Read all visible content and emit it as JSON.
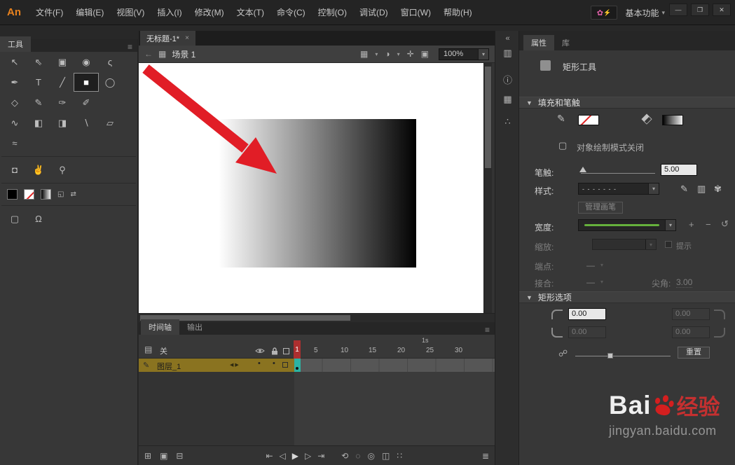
{
  "colors": {
    "stage_gradient_from": "#ffffff",
    "stage_gradient_to": "#000000",
    "annotation_arrow": "#e11d26",
    "playhead": "#ad2f2f",
    "layer_highlight": "#8a7320",
    "selected_frame": "#2bb3a3",
    "width_profile_green": "#66b13c",
    "baidu_red": "#d31f1f",
    "logo_orange": "#e8821e"
  },
  "menubar": {
    "logo": "An",
    "items": [
      "文件(F)",
      "编辑(E)",
      "视图(V)",
      "插入(I)",
      "修改(M)",
      "文本(T)",
      "命令(C)",
      "控制(O)",
      "调试(D)",
      "窗口(W)",
      "帮助(H)"
    ],
    "flower_icon": "✿",
    "spark_icon": "⚡",
    "workspace_label": "基本功能",
    "caret_icon": "▾",
    "minimize_icon": "—",
    "restore_icon": "❐",
    "close_icon": "✕"
  },
  "tools_panel": {
    "title": "工具",
    "panel_menu_icon": "≡",
    "selected_tool": "rectangle",
    "tools": [
      {
        "name": "selection",
        "glyph": "↖"
      },
      {
        "name": "subselection",
        "glyph": "⇖"
      },
      {
        "name": "free-transform",
        "glyph": "▣"
      },
      {
        "name": "3d-rotation",
        "glyph": "◉"
      },
      {
        "name": "lasso",
        "glyph": "ς"
      },
      {
        "name": "pen",
        "glyph": "✒"
      },
      {
        "name": "text",
        "glyph": "T"
      },
      {
        "name": "line",
        "glyph": "╱"
      },
      {
        "name": "rectangle",
        "glyph": "■"
      },
      {
        "name": "oval",
        "glyph": "◯"
      },
      {
        "name": "polystar",
        "glyph": "◇"
      },
      {
        "name": "pencil",
        "glyph": "✎"
      },
      {
        "name": "brush",
        "glyph": "✑"
      },
      {
        "name": "paint-brush",
        "glyph": "✐"
      },
      {
        "name": "asset-warp",
        "glyph": "∿"
      },
      {
        "name": "paint-bucket",
        "glyph": "◧"
      },
      {
        "name": "ink-bottle",
        "glyph": "◨"
      },
      {
        "name": "eyedropper",
        "glyph": "∖"
      },
      {
        "name": "eraser",
        "glyph": "▱"
      },
      {
        "name": "width",
        "glyph": "≈"
      },
      {
        "name": "camera",
        "glyph": "◘"
      },
      {
        "name": "hand",
        "glyph": "✌"
      },
      {
        "name": "zoom",
        "glyph": "⚲"
      }
    ],
    "stroke_swatch": "#000000",
    "fill_swatch": "none",
    "gradient_swatch": "black-to-white",
    "default_colors_icon": "◱",
    "swap_colors_icon": "⇄",
    "object_drawing_icon": "▢",
    "snap_icon": "Ω"
  },
  "document": {
    "tab_title": "无标题-1*",
    "close_icon": "×",
    "back_icon": "←",
    "clapper_icon": "▦",
    "scene_label": "场景 1",
    "symbol_icon": "◑",
    "center_icon": "✛",
    "clip_icon": "▣",
    "caret_icon": "▾",
    "zoom_value": "100%"
  },
  "timeline": {
    "tab_timeline": "时间轴",
    "tab_output": "输出",
    "panel_menu_icon": "≡",
    "film_icon": "▤",
    "advanced_layers_label": "关",
    "layer_icon": "✎",
    "layer_name": "图层_1",
    "layer_nav": "◀ ▶",
    "eye_dot": "•",
    "lock_dot": "•",
    "ruler": {
      "current": "1",
      "f5": "5",
      "f10": "10",
      "f15": "15",
      "f20": "20",
      "f25": "25",
      "f30": "30",
      "second": "1s"
    },
    "bottom": {
      "new_layer": "⊞",
      "new_folder": "▣",
      "delete": "⊟",
      "first": "⇤",
      "prev": "◁",
      "play": "▶",
      "next": "▷",
      "last": "⇥",
      "loop": "⟲",
      "onion": "◌",
      "onion_outline": "◎",
      "multi_frame": "◫",
      "markers": "∷",
      "menu": "≣"
    }
  },
  "dock": {
    "expand": "«",
    "align": "▥",
    "info": "ⓘ",
    "transform": "▦",
    "motion": "∴"
  },
  "properties": {
    "tab_properties": "属性",
    "tab_library": "库",
    "tool_title": "矩形工具",
    "section_caret": "▼",
    "caret_icon": "▾",
    "section_fill_stroke": "填充和笔触",
    "stroke_pencil_icon": "✎",
    "fill_bucket_icon": "◧",
    "object_drawing_icon": "▢",
    "object_drawing_label": "对象绘制模式关闭",
    "stroke_label": "笔触:",
    "stroke_value": "5.00",
    "style_label": "样式:",
    "style_preview": "- - - - - - -",
    "style_edit_icon": "✎",
    "brush_library_icon": "▥",
    "brush_icon": "✾",
    "manage_brushes_label": "管理画笔",
    "width_label": "宽度:",
    "plus_icon": "+",
    "minus_icon": "−",
    "reset_icon": "↺",
    "scale_label": "缩放:",
    "hint_label": "提示",
    "cap_label": "端点:",
    "cap_value": "—",
    "join_label": "接合:",
    "join_value": "—",
    "miter_label": "尖角:",
    "miter_value": "3.00",
    "section_rect_options": "矩形选项",
    "corner_tl": "0.00",
    "corner_tr": "0.00",
    "corner_bl": "0.00",
    "corner_br": "0.00",
    "link_icon": "☍",
    "reset_label": "重置"
  },
  "watermark": {
    "bai": "Bai",
    "brand": "经验",
    "url": "jingyan.baidu.com"
  }
}
